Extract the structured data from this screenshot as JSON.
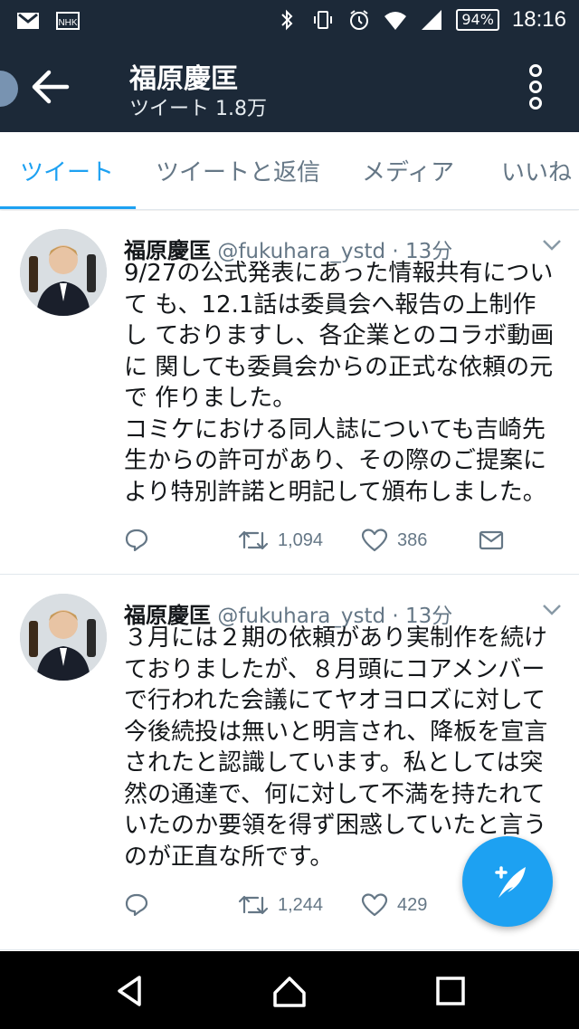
{
  "status_bar": {
    "icons": [
      "gmail-icon",
      "nhk-icon",
      "bluetooth-icon",
      "vibrate-icon",
      "alarm-icon",
      "wifi-icon",
      "signal-icon"
    ],
    "battery": "94%",
    "time": "18:16"
  },
  "header": {
    "title": "福原慶匡",
    "subtitle": "ツイート 1.8万"
  },
  "tabs": [
    {
      "label": "ツイート",
      "active": true
    },
    {
      "label": "ツイートと返信",
      "active": false
    },
    {
      "label": "メディア",
      "active": false
    },
    {
      "label": "いいね",
      "active": false
    }
  ],
  "tweets": [
    {
      "name": "福原慶匡",
      "handle": "@fukuhara_ystd",
      "time": "· 13分",
      "text": "9/27の公式発表にあった情報共有について も、12.1話は委員会へ報告の上制作し ておりますし、各企業とのコラボ動画に 関しても委員会からの正式な依頼の元で 作りました。\nコミケにおける同人誌についても吉崎先 生からの許可があり、その際のご提案に より特別許諾と明記して頒布しました。",
      "retweets": "1,094",
      "likes": "386"
    },
    {
      "name": "福原慶匡",
      "handle": "@fukuhara_ystd",
      "time": "· 13分",
      "text": "３月には２期の依頼があり実制作を続け ておりましたが、８月頭にコアメンバー で行われた会議にてヤオヨロズに対して 今後続投は無いと明言され、降板を宣言 されたと認識しています。私としては突 然の通達で、何に対して不満を持たれて いたのか要領を得ず困惑していたと言う のが正直な所です。",
      "retweets": "1,244",
      "likes": "429"
    }
  ],
  "colors": {
    "header_bg": "#1c2938",
    "accent": "#1da1f2",
    "secondary_text": "#657786"
  }
}
